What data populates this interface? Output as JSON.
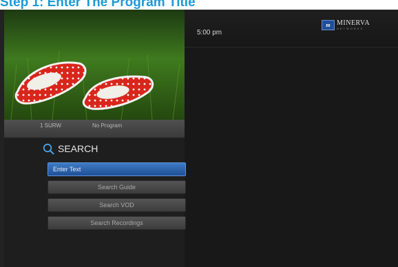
{
  "page": {
    "step_title": "Step 1: Enter The Program Title"
  },
  "header": {
    "time": "5:00 pm",
    "logo_mark": "m",
    "logo_name": "MINERVA",
    "logo_sub": "NETWORKS"
  },
  "preview": {
    "channel": "1  SURW",
    "program": "No Program"
  },
  "search": {
    "title": "SEARCH",
    "items": [
      {
        "label": "Enter Text",
        "selected": true
      },
      {
        "label": "Search Guide",
        "selected": false
      },
      {
        "label": "Search VOD",
        "selected": false
      },
      {
        "label": "Search Recordings",
        "selected": false
      }
    ]
  },
  "colors": {
    "title_blue": "#1c9ad6",
    "selected_blue": "#2a62ad",
    "background": "#1e1e1e"
  }
}
